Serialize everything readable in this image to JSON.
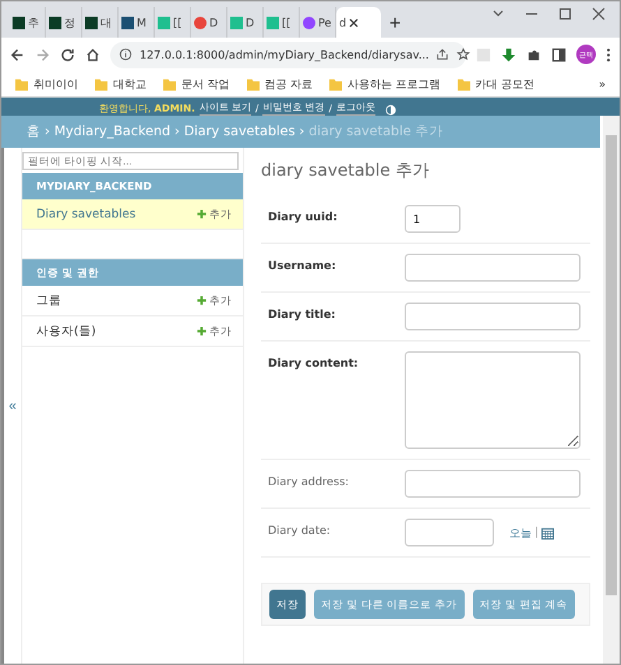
{
  "browser": {
    "tabs": [
      {
        "title": "추",
        "selected": false,
        "kind": "django"
      },
      {
        "title": "정",
        "selected": false,
        "kind": "django"
      },
      {
        "title": "대",
        "selected": false,
        "kind": "django"
      },
      {
        "title": "M",
        "selected": false,
        "kind": "globe"
      },
      {
        "title": "[[",
        "selected": false,
        "kind": "square"
      },
      {
        "title": "D",
        "selected": false,
        "kind": "dot"
      },
      {
        "title": "D",
        "selected": false,
        "kind": "square"
      },
      {
        "title": "[[",
        "selected": false,
        "kind": "square"
      },
      {
        "title": "Pe",
        "selected": false,
        "kind": "circle"
      },
      {
        "title": "d",
        "selected": true,
        "kind": "plain"
      }
    ],
    "new_tab": "+",
    "url": "127.0.0.1:8000/admin/myDiary_Backend/diarysav...",
    "profile": "근택",
    "bookmarks": [
      "취미이이",
      "대학교",
      "문서 작업",
      "컴공 자료",
      "사용하는 프로그램",
      "카대 공모전"
    ],
    "more": "»"
  },
  "header": {
    "welcome": "환영합니다,",
    "user": "ADMIN.",
    "items": [
      {
        "text": "사이트 보기",
        "kind": "link"
      },
      {
        "text": "/",
        "kind": "sep"
      },
      {
        "text": "비밀번호 변경",
        "kind": "link"
      },
      {
        "text": "/",
        "kind": "sep"
      },
      {
        "text": "로그아웃",
        "kind": "link"
      }
    ]
  },
  "breadcrumbs": [
    {
      "label": "홈",
      "kind": "link"
    },
    {
      "label": "›",
      "kind": "sep"
    },
    {
      "label": "Mydiary_Backend",
      "kind": "link"
    },
    {
      "label": "›",
      "kind": "sep"
    },
    {
      "label": "Diary savetables",
      "kind": "link"
    },
    {
      "label": "›",
      "kind": "sep"
    },
    {
      "label": "diary savetable 추가",
      "kind": "current"
    }
  ],
  "sidebar": {
    "filter_placeholder": "필터에 타이핑 시작...",
    "collapse": "«",
    "apps": [
      {
        "name": "MYDIARY_BACKEND",
        "models": [
          {
            "name": "Diary savetables",
            "add": "추가",
            "selected": true
          }
        ]
      },
      {
        "name": "인증 및 권한",
        "models": [
          {
            "name": "그룹",
            "add": "추가",
            "selected": false
          },
          {
            "name": "사용자(들)",
            "add": "추가",
            "selected": false
          }
        ]
      }
    ]
  },
  "form": {
    "title": "diary savetable 추가",
    "fields": [
      {
        "label": "Diary uuid:",
        "kind": "short",
        "required": true,
        "value": "1"
      },
      {
        "label": "Username:",
        "kind": "text",
        "required": true
      },
      {
        "label": "Diary title:",
        "kind": "text",
        "required": true
      },
      {
        "label": "Diary content:",
        "kind": "textarea",
        "required": true
      },
      {
        "label": "Diary address:",
        "kind": "text",
        "required": false
      },
      {
        "label": "Diary date:",
        "kind": "date",
        "required": false,
        "today": "오늘",
        "divider": "|"
      }
    ],
    "buttons": [
      {
        "label": "저장",
        "default": true
      },
      {
        "label": "저장 및 다른 이름으로 추가",
        "default": false
      },
      {
        "label": "저장 및 편집 계속",
        "default": false
      }
    ]
  }
}
